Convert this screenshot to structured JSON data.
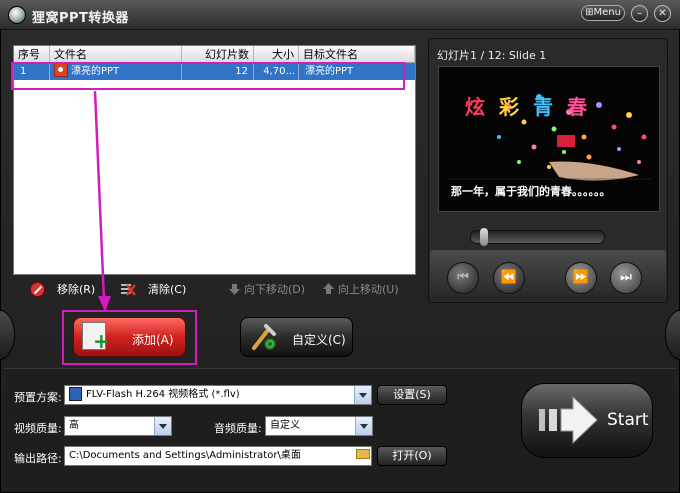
{
  "window": {
    "title": "狸窝PPT转换器",
    "menu_label": "Menu",
    "menu_prefix": "⊞"
  },
  "file_list": {
    "columns": [
      "序号",
      "文件名",
      "幻灯片数",
      "大小",
      "目标文件名"
    ],
    "rows": [
      {
        "index": "1",
        "name": "漂亮的PPT",
        "slides": "12",
        "size": "4,70...",
        "target": "漂亮的PPT"
      }
    ]
  },
  "list_toolbar": {
    "remove": "移除(R)",
    "clear": "清除(C)",
    "move_down": "向下移动(D)",
    "move_up": "向上移动(U)"
  },
  "preview": {
    "title": "幻灯片1 / 12: Slide 1",
    "slide_heading_chars": [
      "炫",
      "彩",
      "青",
      "春"
    ],
    "slide_caption": "那一年，属于我们的青春。。。。。。",
    "progress": 0.05
  },
  "actions": {
    "add_label": "添加(A)",
    "custom_label": "自定义(C)"
  },
  "settings": {
    "preset_label": "预置方案:",
    "preset_value": "FLV-Flash H.264 视频格式 (*.flv)",
    "settings_button": "设置(S)",
    "video_quality_label": "视频质量:",
    "video_quality_value": "高",
    "audio_quality_label": "音频质量:",
    "audio_quality_value": "自定义",
    "output_path_label": "输出路径:",
    "output_path_value": "C:\\Documents and Settings\\Administrator\\桌面",
    "open_button": "打开(O)",
    "start_label": "Start"
  },
  "colors": {
    "highlight_magenta": "#d21cbe",
    "selection_blue": "#3173c6",
    "add_red": "#d0231f"
  }
}
